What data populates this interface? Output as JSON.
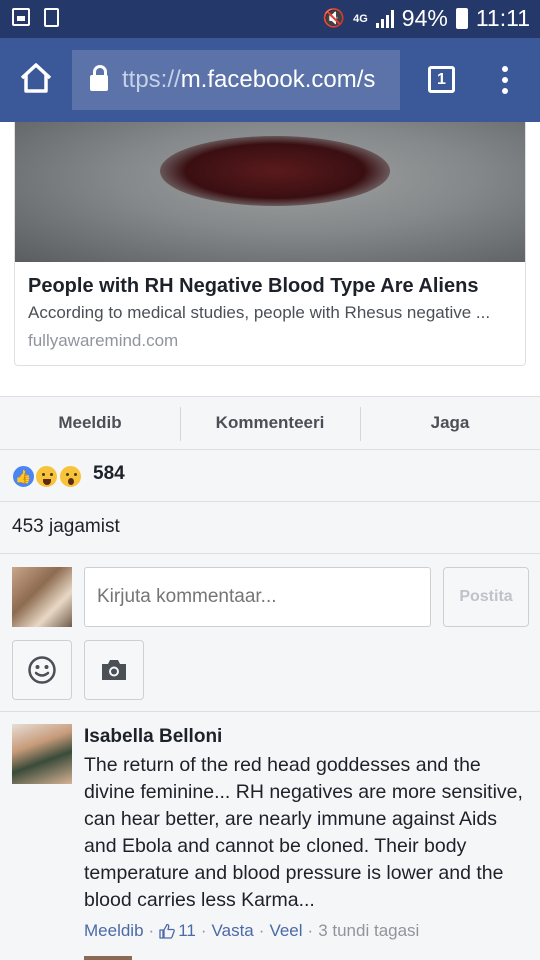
{
  "status_bar": {
    "battery": "94%",
    "time": "11:11",
    "network_type": "4G"
  },
  "browser": {
    "url_prefix": "ttps://",
    "url_host": "m.facebook.com/s",
    "tab_count": "1",
    "icons": [
      "home-icon",
      "lock-icon",
      "tabs-icon",
      "overflow-menu-icon"
    ]
  },
  "link_preview": {
    "title": "People with RH Negative Blood Type Are Aliens",
    "description": "According to medical studies, people with Rhesus negative ...",
    "domain": "fullyawaremind.com"
  },
  "actions": {
    "like": "Meeldib",
    "comment": "Kommenteeri",
    "share": "Jaga"
  },
  "reactions": {
    "count": "584",
    "types": [
      "like",
      "haha",
      "wow"
    ]
  },
  "shares": {
    "label": "453 jagamist"
  },
  "composer": {
    "placeholder": "Kirjuta kommentaar...",
    "post_label": "Postita"
  },
  "comment": {
    "author": "Isabella Belloni",
    "text": "The return of the red head goddesses and the divine feminine... RH negatives are more sensitive, can hear better, are nearly immune against Aids and Ebola and cannot be cloned. Their body temperature and blood pressure is lower and the blood carries less Karma...",
    "like_label": "Meeldib",
    "like_count": "11",
    "reply_label": "Vasta",
    "more_label": "Veel",
    "time": "3 tundi tagasi"
  },
  "colors": {
    "facebook_blue": "#3b5998",
    "status_bar": "#25386a",
    "link_blue": "#4b6aa8"
  }
}
